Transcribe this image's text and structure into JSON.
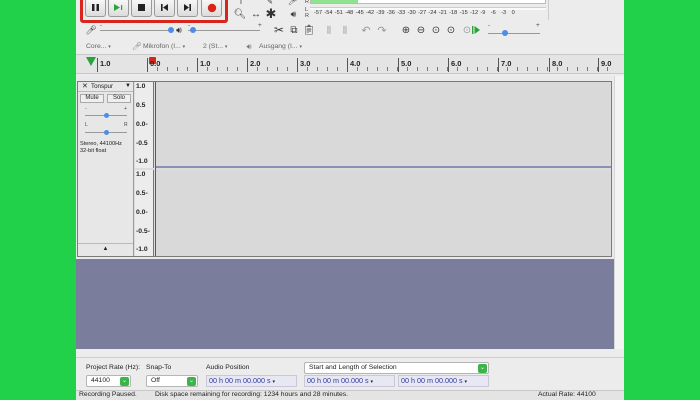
{
  "toolbar": {
    "transport": [
      "pause",
      "play",
      "stop",
      "skip-start",
      "skip-end",
      "record"
    ],
    "meter_l": "L",
    "meter_r": "R",
    "meter_scale": [
      "-57",
      "-54",
      "-51",
      "-48",
      "-45",
      "-42",
      "-39",
      "-36",
      "-33",
      "-30",
      "-27",
      "-24",
      "-21",
      "-18",
      "-15",
      "-12",
      "-9",
      "-6",
      "-3",
      "0"
    ],
    "slider_minus": "-",
    "slider_plus": "+"
  },
  "devices": {
    "host": "Core...",
    "recording_device": "Mikrofon (I...",
    "channels": "2 (St...",
    "playback_device": "Ausgang (I..."
  },
  "ruler": {
    "ticks": [
      "1.0",
      "0.0",
      "1.0",
      "2.0",
      "3.0",
      "4.0",
      "5.0",
      "6.0",
      "7.0",
      "8.0",
      "9.0"
    ]
  },
  "track": {
    "name": "Tonspur",
    "mute": "Mute",
    "solo": "Solo",
    "gain_minus": "-",
    "gain_plus": "+",
    "pan_left": "L",
    "pan_right": "R",
    "info_line1": "Stereo, 44100Hz",
    "info_line2": "32-bit float",
    "scale": [
      "1.0",
      "0.5",
      "0.0-",
      "-0.5",
      "-1.0"
    ],
    "scale2": [
      "1.0",
      "0.5-",
      "0.0-",
      "-0.5-",
      "-1.0"
    ]
  },
  "selection_bar": {
    "project_rate_label": "Project Rate (Hz):",
    "project_rate_value": "44100",
    "snap_to_label": "Snap-To",
    "snap_to_value": "Off",
    "audio_position_label": "Audio Position",
    "audio_position_value": "00 h 00 m 00.000 s",
    "selection_mode": "Start and Length of Selection",
    "selection_start": "00 h 00 m 00.000 s",
    "selection_end": "00 h 00 m 00.000 s"
  },
  "status_bar": {
    "state": "Recording Paused.",
    "disk_space": "Disk space remaining for recording: 1234 hours and 28 minutes.",
    "actual_rate": "Actual Rate: 44100"
  },
  "colors": {
    "background": "#21d14a",
    "highlight_box": "#d9261c",
    "record_red": "#d9261c",
    "empty_area": "#7a7d9c",
    "time_text": "#2e3a96"
  }
}
